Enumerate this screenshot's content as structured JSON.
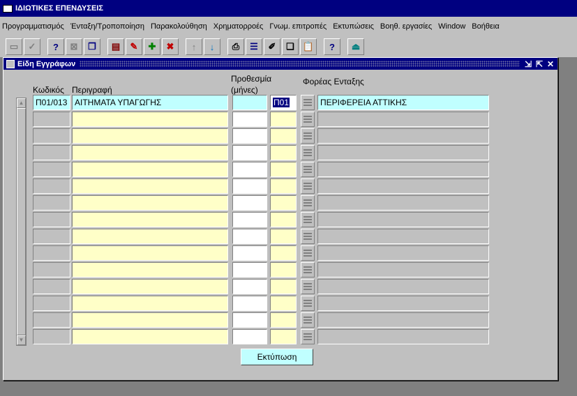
{
  "window": {
    "title": "ΙΔΙΩΤΙΚΕΣ ΕΠΕΝΔΥΣΕΙΣ"
  },
  "menu": [
    "Προγραμματισμός",
    "Ένταξη/Τροποποίηση",
    "Παρακολούθηση",
    "Χρηματορροές",
    "Γνωμ. επιτροπές",
    "Εκτυπώσεις",
    "Βοηθ. εργασίες",
    "Window",
    "Βοήθεια"
  ],
  "toolbar_icons": [
    "save-icon",
    "check-icon",
    "query-icon",
    "cancel-query-icon",
    "copy-icon",
    "save-record-icon",
    "edit-icon",
    "add-icon",
    "delete-icon",
    "up-icon",
    "down-icon",
    "print-icon",
    "list-icon",
    "edit-field-icon",
    "copy-field-icon",
    "paste-icon",
    "help-icon",
    "exit-icon"
  ],
  "form": {
    "title": "Είδη Εγγράφων",
    "headers": {
      "code": "Κωδικός",
      "description": "Περιγραφή",
      "months_line1": "Προθεσμία",
      "months_line2": "(μήνες)",
      "agency": "Φορέας Ενταξης"
    },
    "rows": [
      {
        "code": "Π01/013",
        "description": "ΑΙΤΗΜΑΤΑ ΥΠΑΓΩΓΗΣ",
        "months": "",
        "agency_code": "Π01",
        "agency": "ΠΕΡΙΦΕΡΕΙΑ ΑΤΤΙΚΗΣ"
      },
      {
        "code": "",
        "description": "",
        "months": "",
        "agency_code": "",
        "agency": ""
      },
      {
        "code": "",
        "description": "",
        "months": "",
        "agency_code": "",
        "agency": ""
      },
      {
        "code": "",
        "description": "",
        "months": "",
        "agency_code": "",
        "agency": ""
      },
      {
        "code": "",
        "description": "",
        "months": "",
        "agency_code": "",
        "agency": ""
      },
      {
        "code": "",
        "description": "",
        "months": "",
        "agency_code": "",
        "agency": ""
      },
      {
        "code": "",
        "description": "",
        "months": "",
        "agency_code": "",
        "agency": ""
      },
      {
        "code": "",
        "description": "",
        "months": "",
        "agency_code": "",
        "agency": ""
      },
      {
        "code": "",
        "description": "",
        "months": "",
        "agency_code": "",
        "agency": ""
      },
      {
        "code": "",
        "description": "",
        "months": "",
        "agency_code": "",
        "agency": ""
      },
      {
        "code": "",
        "description": "",
        "months": "",
        "agency_code": "",
        "agency": ""
      },
      {
        "code": "",
        "description": "",
        "months": "",
        "agency_code": "",
        "agency": ""
      },
      {
        "code": "",
        "description": "",
        "months": "",
        "agency_code": "",
        "agency": ""
      },
      {
        "code": "",
        "description": "",
        "months": "",
        "agency_code": "",
        "agency": ""
      },
      {
        "code": "",
        "description": "",
        "months": "",
        "agency_code": "",
        "agency": ""
      }
    ],
    "print_button": "Εκτύπωση"
  }
}
